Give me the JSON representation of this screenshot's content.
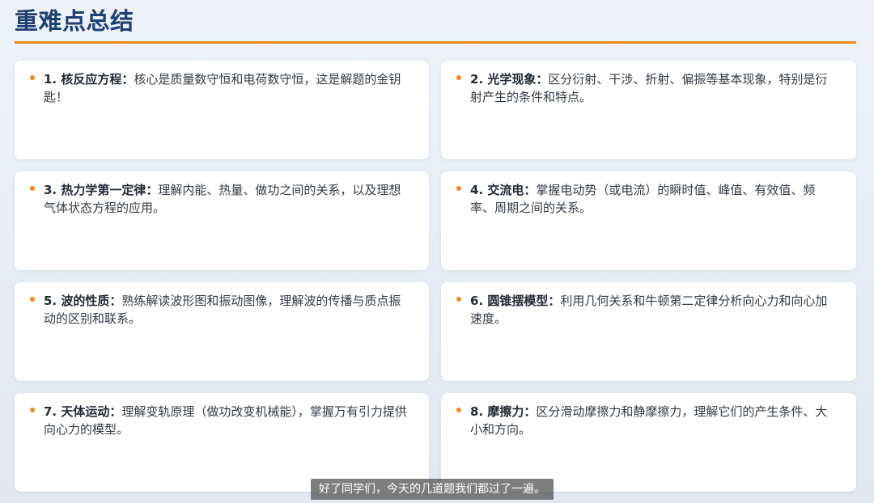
{
  "page": {
    "title": "重难点总结"
  },
  "cards": [
    {
      "head": "1. 核反应方程：",
      "body": "核心是质量数守恒和电荷数守恒，这是解题的金钥匙！"
    },
    {
      "head": "2. 光学现象：",
      "body": "区分衍射、干涉、折射、偏振等基本现象，特别是衍射产生的条件和特点。"
    },
    {
      "head": "3. 热力学第一定律：",
      "body": "理解内能、热量、做功之间的关系，以及理想气体状态方程的应用。"
    },
    {
      "head": "4. 交流电：",
      "body": "掌握电动势（或电流）的瞬时值、峰值、有效值、频率、周期之间的关系。"
    },
    {
      "head": "5. 波的性质：",
      "body": "熟练解读波形图和振动图像，理解波的传播与质点振动的区别和联系。"
    },
    {
      "head": "6. 圆锥摆模型：",
      "body": "利用几何关系和牛顿第二定律分析向心力和向心加速度。"
    },
    {
      "head": "7. 天体运动：",
      "body": "理解变轨原理（做功改变机械能），掌握万有引力提供向心力的模型。"
    },
    {
      "head": "8. 摩擦力：",
      "body": "区分滑动摩擦力和静摩擦力，理解它们的产生条件、大小和方向。"
    }
  ],
  "subtitle": {
    "text": "好了同学们，今天的几道题我们都过了一遍。"
  },
  "colors": {
    "title": "#1d3f72",
    "accent": "#f08a1e",
    "card_bg": "#ffffff"
  }
}
